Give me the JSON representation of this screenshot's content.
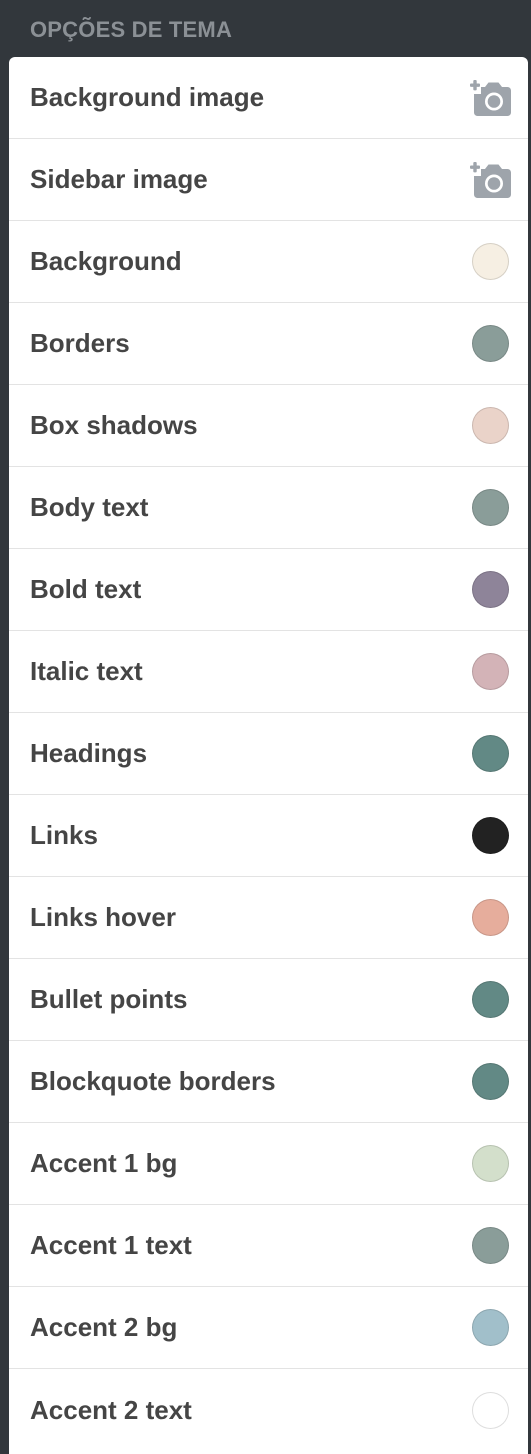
{
  "section": {
    "title": "OPÇÕES DE TEMA"
  },
  "options": [
    {
      "label": "Background image",
      "type": "image",
      "icon": "add-photo-camera-icon"
    },
    {
      "label": "Sidebar image",
      "type": "image",
      "icon": "add-photo-camera-icon"
    },
    {
      "label": "Background",
      "type": "color",
      "color": "#f6efe3"
    },
    {
      "label": "Borders",
      "type": "color",
      "color": "#8a9d99"
    },
    {
      "label": "Box shadows",
      "type": "color",
      "color": "#ead3c9"
    },
    {
      "label": "Body text",
      "type": "color",
      "color": "#8a9d99"
    },
    {
      "label": "Bold text",
      "type": "color",
      "color": "#8e8499"
    },
    {
      "label": "Italic text",
      "type": "color",
      "color": "#d3b3b7"
    },
    {
      "label": "Headings",
      "type": "color",
      "color": "#628985"
    },
    {
      "label": "Links",
      "type": "color",
      "color": "#222222"
    },
    {
      "label": "Links hover",
      "type": "color",
      "color": "#e6ad9c"
    },
    {
      "label": "Bullet points",
      "type": "color",
      "color": "#628985"
    },
    {
      "label": "Blockquote borders",
      "type": "color",
      "color": "#628985"
    },
    {
      "label": "Accent 1 bg",
      "type": "color",
      "color": "#d3dfcb"
    },
    {
      "label": "Accent 1 text",
      "type": "color",
      "color": "#8a9d99"
    },
    {
      "label": "Accent 2 bg",
      "type": "color",
      "color": "#a1bfca"
    },
    {
      "label": "Accent 2 text",
      "type": "color",
      "color": "#ffffff"
    }
  ]
}
